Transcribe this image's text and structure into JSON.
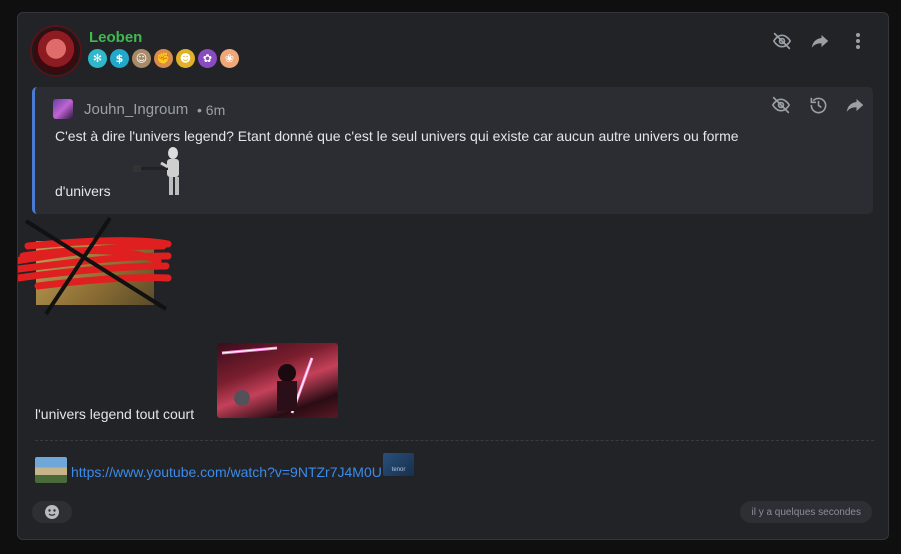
{
  "post": {
    "author": "Leoben",
    "author_color": "#3fb950",
    "badges": [
      {
        "icon": "snowflake-badge-icon",
        "glyph": "✻",
        "color": "#2fb8c9"
      },
      {
        "icon": "dollar-badge-icon",
        "glyph": "$",
        "color": "#22a9c9"
      },
      {
        "icon": "gnome-badge-icon",
        "glyph": "☺",
        "color": "#a88c6a"
      },
      {
        "icon": "muscle-badge-icon",
        "glyph": "✊",
        "color": "#d98b4b"
      },
      {
        "icon": "smiley-badge-icon",
        "glyph": "☻",
        "color": "#e2b12a"
      },
      {
        "icon": "purple-monster-badge-icon",
        "glyph": "✿",
        "color": "#8a4bc1"
      },
      {
        "icon": "girl-face-badge-icon",
        "glyph": "❀",
        "color": "#f0a878"
      }
    ],
    "quote": {
      "author": "Jouhn_Ingroum",
      "time": "• 6m",
      "text_line1": "C'est à dire l'univers legend? Etant donné que c'est le seul univers qui existe car aucun autre univers ou forme",
      "text_line2": "d'univers"
    },
    "legend_text": "l'univers legend tout court",
    "youtube_link": "https://www.youtube.com/watch?v=9NTZr7J4M0U",
    "tenor_label": "tenor",
    "timestamp": "il y a quelques secondes"
  },
  "colors": {
    "background": "#0f0f10",
    "card": "#222327",
    "quote_bg": "#2c2d32",
    "quote_accent": "#4a7bd0",
    "link": "#3b8beb"
  }
}
